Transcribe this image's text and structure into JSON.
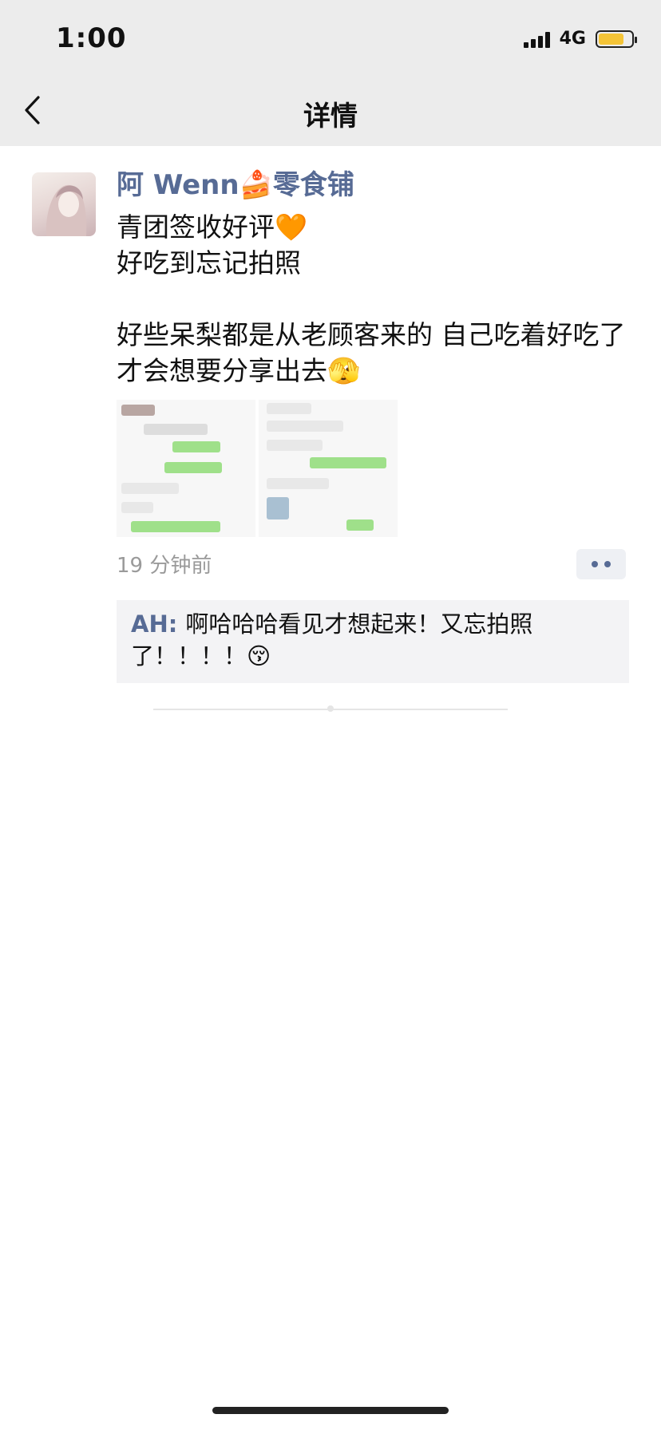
{
  "status": {
    "time": "1:00",
    "network": "4G"
  },
  "nav": {
    "title": "详情",
    "back_icon": "chevron-left-icon"
  },
  "post": {
    "author": "阿 Wenn🍰零食铺",
    "text": "青团签收好评🧡\n好吃到忘记拍照\n\n好些呆梨都是从老顾客来的 自己吃着好吃了才会想要分享出去🫣",
    "time_ago": "19 分钟前"
  },
  "comments": [
    {
      "name": "AH",
      "separator": ": ",
      "text": "啊哈哈哈看见才想起来！又忘拍照了！！！！😚"
    }
  ],
  "colors": {
    "link": "#576b95",
    "topbar": "#ececec",
    "battery": "#f4c437"
  }
}
